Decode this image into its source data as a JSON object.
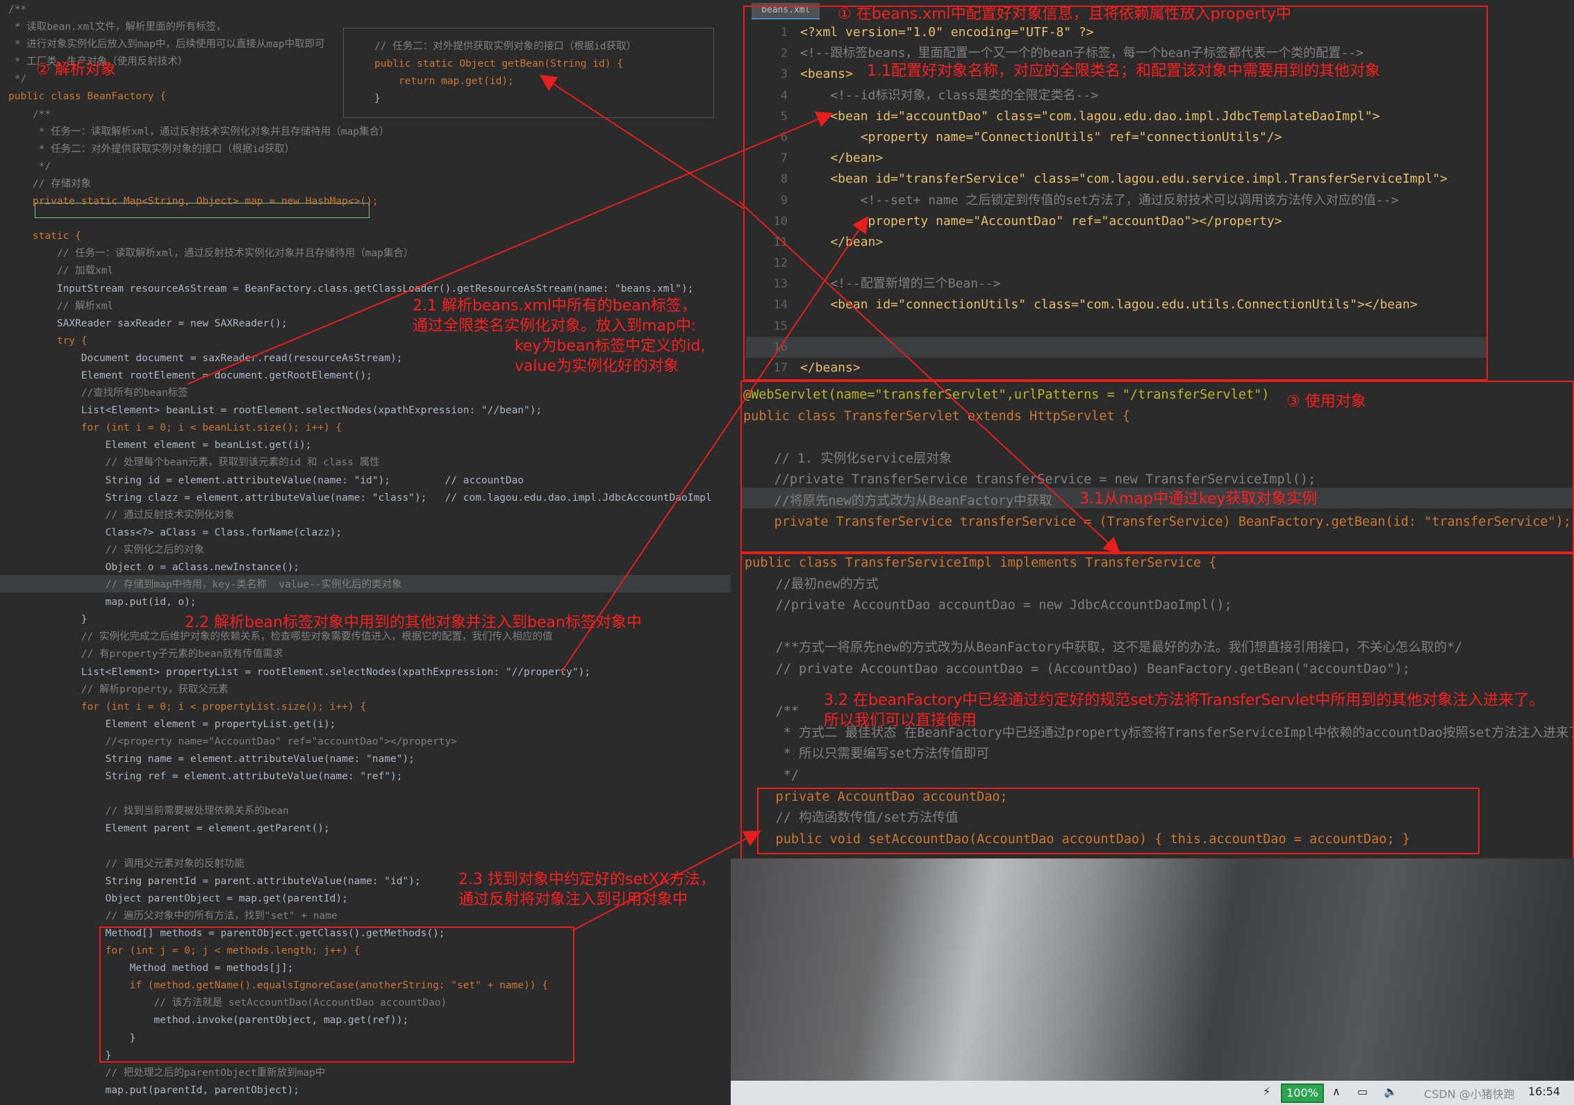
{
  "left": {
    "lines": [
      "/**",
      " * 读取bean.xml文件，解析里面的所有标签，",
      " * 进行对象实例化后放入到map中，后续使用可以直接从map中取即可",
      " * 工厂类，生产对象（使用反射技术）",
      " */",
      "public class BeanFactory {",
      "    /**",
      "     * 任务一：读取解析xml，通过反射技术实例化对象并且存储待用（map集合）",
      "     * 任务二：对外提供获取实例对象的接口（根据id获取）",
      "     */",
      "    // 存储对象",
      "    private static Map<String, Object> map = new HashMap<>();",
      "",
      "    static {",
      "        // 任务一：读取解析xml，通过反射技术实例化对象并且存储待用（map集合）",
      "        // 加载xml",
      "        InputStream resourceAsStream = BeanFactory.class.getClassLoader().getResourceAsStream(name: \"beans.xml\");",
      "        // 解析xml",
      "        SAXReader saxReader = new SAXReader();",
      "        try {",
      "            Document document = saxReader.read(resourceAsStream);",
      "            Element rootElement = document.getRootElement();",
      "            //查找所有的bean标签",
      "            List<Element> beanList = rootElement.selectNodes(xpathExpression: \"//bean\");",
      "            for (int i = 0; i < beanList.size(); i++) {",
      "                Element element = beanList.get(i);",
      "                // 处理每个bean元素，获取到该元素的id 和 class 属性",
      "                String id = element.attributeValue(name: \"id\");         // accountDao",
      "                String clazz = element.attributeValue(name: \"class\");   // com.lagou.edu.dao.impl.JdbcAccountDaoImpl",
      "                // 通过反射技术实例化对象",
      "                Class<?> aClass = Class.forName(clazz);",
      "                // 实例化之后的对象",
      "                Object o = aClass.newInstance();",
      "                // 存储到map中待用，key-类名称  value--实例化后的类对象",
      "                map.put(id, o);",
      "            }",
      "            // 实例化完成之后维护对象的依赖关系，检查哪些对象需要传值进入，根据它的配置，我们传入相应的值",
      "            // 有property子元素的bean就有传值需求",
      "            List<Element> propertyList = rootElement.selectNodes(xpathExpression: \"//property\");",
      "            // 解析property，获取父元素",
      "            for (int i = 0; i < propertyList.size(); i++) {",
      "                Element element = propertyList.get(i);",
      "                //<property name=\"AccountDao\" ref=\"accountDao\"></property>",
      "                String name = element.attributeValue(name: \"name\");",
      "                String ref = element.attributeValue(name: \"ref\");",
      "",
      "                // 找到当前需要被处理依赖关系的bean",
      "                Element parent = element.getParent();",
      "",
      "                // 调用父元素对象的反射功能",
      "                String parentId = parent.attributeValue(name: \"id\");",
      "                Object parentObject = map.get(parentId);",
      "                // 遍历父对象中的所有方法，找到\"set\" + name",
      "                Method[] methods = parentObject.getClass().getMethods();",
      "                for (int j = 0; j < methods.length; j++) {",
      "                    Method method = methods[j];",
      "                    if (method.getName().equalsIgnoreCase(anotherString: \"set\" + name)) {",
      "                        // 该方法就是 setAccountDao(AccountDao accountDao)",
      "                        method.invoke(parentObject, map.get(ref));",
      "                    }",
      "                }",
      "                // 把处理之后的parentObject重新放到map中",
      "                map.put(parentId, parentObject);"
    ],
    "inset_lines": [
      "// 任务二：对外提供获取实例对象的接口（根据id获取）",
      "public static Object getBean(String id) {",
      "    return map.get(id);",
      "}"
    ]
  },
  "xml": {
    "tab_label": "beans.xml",
    "gutter": [
      "1",
      "2",
      "3",
      "4",
      "5",
      "6",
      "7",
      "8",
      "9",
      "10",
      "11",
      "12",
      "13",
      "14",
      "15",
      "16",
      "17"
    ],
    "lines": [
      "<?xml version=\"1.0\" encoding=\"UTF-8\" ?>",
      "<!--跟标签beans，里面配置一个又一个的bean子标签，每一个bean子标签都代表一个类的配置-->",
      "<beans>",
      "    <!--id标识对象，class是类的全限定类名-->",
      "    <bean id=\"accountDao\" class=\"com.lagou.edu.dao.impl.JdbcTemplateDaoImpl\">",
      "        <property name=\"ConnectionUtils\" ref=\"connectionUtils\"/>",
      "    </bean>",
      "    <bean id=\"transferService\" class=\"com.lagou.edu.service.impl.TransferServiceImpl\">",
      "        <!--set+ name 之后锁定到传值的set方法了，通过反射技术可以调用该方法传入对应的值-->",
      "        <property name=\"AccountDao\" ref=\"accountDao\"></property>",
      "    </bean>",
      "",
      "    <!--配置新增的三个Bean-->",
      "    <bean id=\"connectionUtils\" class=\"com.lagou.edu.utils.ConnectionUtils\"></bean>",
      "",
      "",
      "</beans>"
    ]
  },
  "servlet": {
    "lines": [
      "@WebServlet(name=\"transferServlet\",urlPatterns = \"/transferServlet\")",
      "public class TransferServlet extends HttpServlet {",
      "",
      "    // 1. 实例化service层对象",
      "    //private TransferService transferService = new TransferServiceImpl();",
      "    //将原先new的方式改为从BeanFactory中获取",
      "    private TransferService transferService = (TransferService) BeanFactory.getBean(id: \"transferService\");"
    ]
  },
  "impl": {
    "lines": [
      "public class TransferServiceImpl implements TransferService {",
      "    //最初new的方式",
      "    //private AccountDao accountDao = new JdbcAccountDaoImpl();",
      "",
      "    /**方式一将原先new的方式改为从BeanFactory中获取，这不是最好的办法。我们想直接引用接口，不关心怎么取的*/",
      "    // private AccountDao accountDao = (AccountDao) BeanFactory.getBean(\"accountDao\");",
      "",
      "    /**",
      "     * 方式二 最佳状态 在BeanFactory中已经通过property标签将TransferServiceImpl中依赖的accountDao按照set方法注入进来了，",
      "     * 所以只需要编写set方法传值即可",
      "     */",
      "    private AccountDao accountDao;",
      "    // 构造函数传值/set方法传值",
      "    public void setAccountDao(AccountDao accountDao) { this.accountDao = accountDao; }"
    ]
  },
  "annotations": {
    "a1": "① 在beans.xml中配置好对象信息，且将依赖属性放入property中",
    "a11": "1.1配置好对象名称，对应的全限类名；和配置该对象中需要用到的其他对象",
    "a2": "② 解析对象",
    "a21": "2.1 解析beans.xml中所有的bean标签，\n通过全限类名实例化对象。放入到map中:\n                     key为bean标签中定义的id,\n                     value为实例化好的对象",
    "a22": "2.2 解析bean标签对象中用到的其他对象并注入到bean标签对象中",
    "a23": "2.3 找到对象中约定好的setXX方法，\n通过反射将对象注入到引用对象中",
    "a3": "③ 使用对象",
    "a31": "3.1从map中通过key获取对象实例",
    "a32": "3.2 在beanFactory中已经通过约定好的规范set方法将TransferServlet中所用到的其他对象注入进来了。\n所以我们可以直接使用"
  },
  "taskbar": {
    "battery": "100%",
    "watermark": "CSDN @小猪快跑",
    "clock": "16:54"
  },
  "colors": {
    "annotation": "#ff1f1f",
    "code_bg": "#2b2b2b",
    "keyword": "#cc7832",
    "string": "#6a8759",
    "comment": "#808080"
  }
}
